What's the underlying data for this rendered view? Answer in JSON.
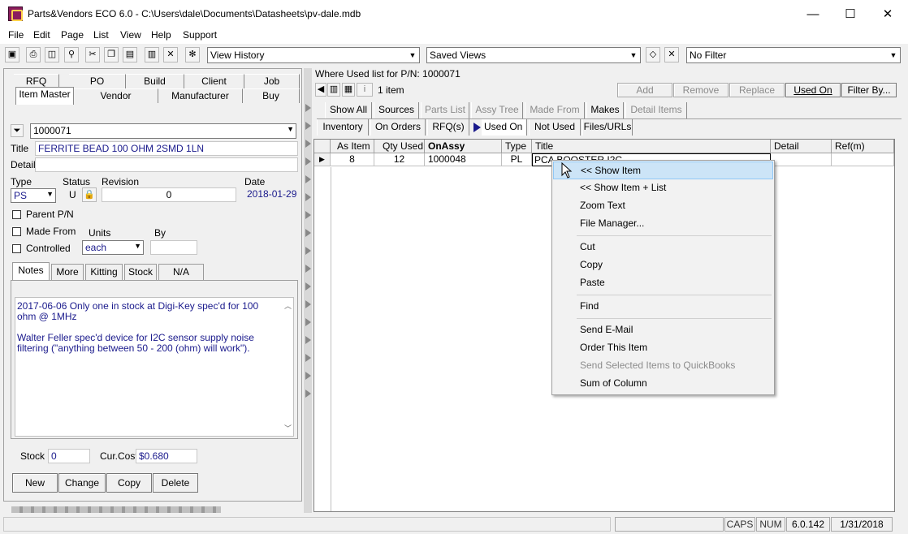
{
  "window": {
    "title": "Parts&Vendors ECO 6.0 - C:\\Users\\dale\\Documents\\Datasheets\\pv-dale.mdb",
    "minimize": "—",
    "maximize": "☐",
    "close": "✕"
  },
  "menu": [
    "File",
    "Edit",
    "Page",
    "List",
    "View",
    "Help",
    "Support"
  ],
  "toolbar": {
    "icons": [
      "save-icon",
      "print-icon",
      "print-preview-icon",
      "find-icon",
      "cut-icon",
      "copy-icon",
      "paste-icon",
      "paste-special-icon",
      "delete-icon",
      "settings-icon"
    ],
    "view_history": "View History",
    "saved_views": "Saved Views",
    "filter": "No Filter"
  },
  "left": {
    "tabs_row1": [
      "RFQ",
      "PO",
      "Build",
      "Client",
      "Job"
    ],
    "tabs_row2": [
      "Item Master",
      "Vendor",
      "Manufacturer",
      "Buy"
    ],
    "part_number": "1000071",
    "title_label": "Title",
    "title_value": "FERRITE BEAD 100 OHM 2SMD 1LN",
    "detail_label": "Detail",
    "detail_value": "",
    "type_label": "Type",
    "type_value": "PS",
    "status_label": "Status",
    "status_value": "U",
    "revision_label": "Revision",
    "revision_value": "0",
    "date_label": "Date",
    "date_value": "2018-01-29",
    "parent_pn": "Parent P/N",
    "made_from": "Made From",
    "controlled": "Controlled",
    "units_label": "Units",
    "units_value": "each",
    "by_label": "By",
    "by_value": "",
    "subtabs": [
      "Notes",
      "More",
      "Kitting",
      "Stock",
      "N/A"
    ],
    "notes": [
      "2017-06-06 Only one in stock at Digi-Key spec'd for 100 ohm @ 1MHz",
      "",
      "Walter Feller spec'd device for I2C sensor supply noise filtering (\"anything between 50 - 200 (ohm) will work\")."
    ],
    "stock_label": "Stock",
    "stock_value": "0",
    "cost_label": "Cur.Cost",
    "cost_value": "$0.680",
    "buttons": [
      "New",
      "Change",
      "Copy",
      "Delete"
    ]
  },
  "right": {
    "header": "Where Used list for P/N:  1000071",
    "count": "1 item",
    "actions": [
      "Add",
      "Remove",
      "Replace",
      "Used On",
      "Filter By..."
    ],
    "tabs_row1": [
      "Show All",
      "Sources",
      "Parts List",
      "Assy Tree",
      "Made From",
      "Makes",
      "Detail Items"
    ],
    "tabs_row2": [
      "Inventory",
      "On Orders",
      "RFQ(s)",
      "Used On",
      "Not Used",
      "Files/URLs"
    ],
    "columns": [
      "As Item",
      "Qty Used",
      "OnAssy",
      "Type",
      "Title",
      "Detail",
      "Ref(m)"
    ],
    "rows": [
      [
        "8",
        "12",
        "1000048",
        "PL",
        "PCA BOOSTER I2C",
        "",
        ""
      ]
    ]
  },
  "context_menu": {
    "items": [
      "<< Show Item",
      "<< Show Item + List",
      "Zoom Text",
      "File Manager...",
      "Cut",
      "Copy",
      "Paste",
      "Find",
      "Send E-Mail",
      "Order This Item",
      "Send Selected Items to QuickBooks",
      "Sum of Column"
    ]
  },
  "status": {
    "caps": "CAPS",
    "num": "NUM",
    "version": "6.0.142",
    "date": "1/31/2018"
  }
}
